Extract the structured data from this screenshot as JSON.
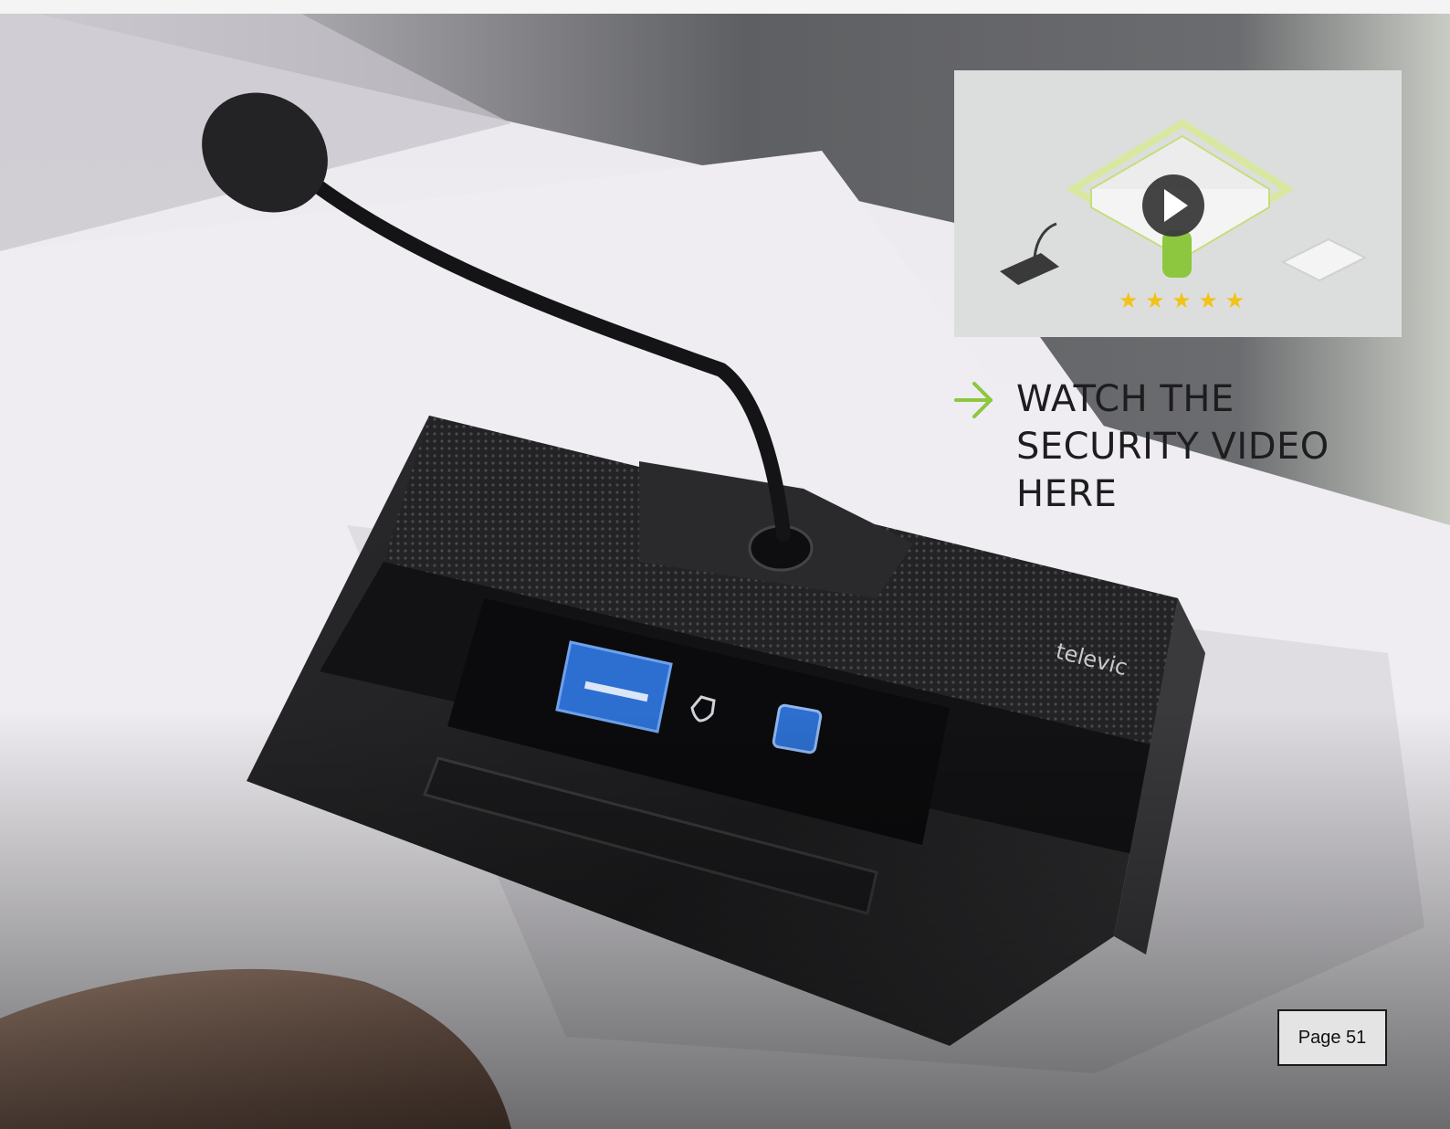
{
  "video": {
    "link_text": "WATCH THE SECURITY VIDEO HERE"
  },
  "device": {
    "brand_logo": "televic"
  },
  "footer": {
    "page_label": "Page 51"
  },
  "colors": {
    "accent_green": "#8dc63f",
    "play_button": "#3a3a3a",
    "stars": "#f2c318",
    "screen_blue": "#2d6fd0"
  },
  "icons": {
    "arrow": "arrow-right-icon",
    "play": "play-icon",
    "shield": "shield-icon"
  }
}
